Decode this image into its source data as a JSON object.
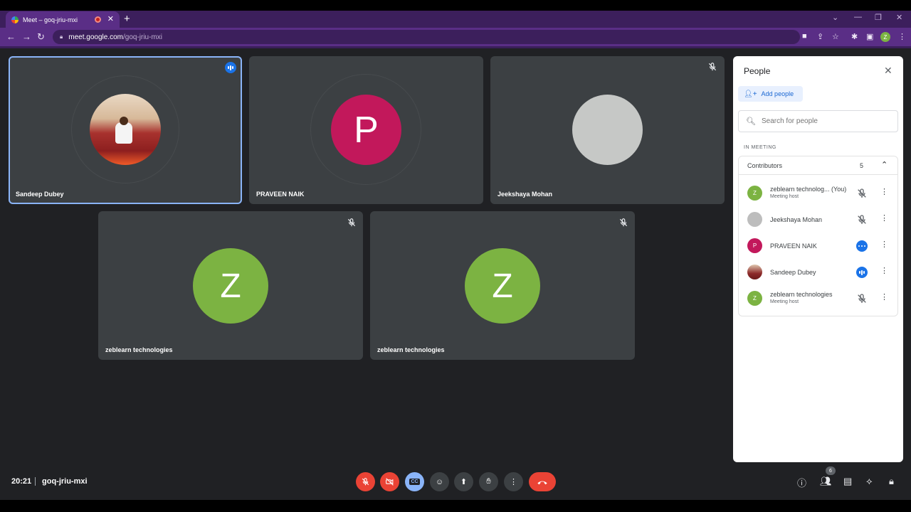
{
  "browser": {
    "tab_title": "Meet – goq-jriu-mxi",
    "tab_close": "✕",
    "new_tab": "+",
    "url_host": "meet.google.com",
    "url_path": "/goq-jriu-mxi",
    "profile_initial": "Z"
  },
  "tiles": [
    {
      "name": "Sandeep Dubey",
      "speaking": true
    },
    {
      "name": "PRAVEEN NAIK",
      "initial": "P",
      "color": "#c2185b"
    },
    {
      "name": "Jeekshaya Mohan",
      "muted": true
    },
    {
      "name": "zeblearn technologies",
      "initial": "Z",
      "color": "#7cb342",
      "muted": true
    },
    {
      "name": "zeblearn technologies",
      "initial": "Z",
      "color": "#7cb342",
      "muted": true
    }
  ],
  "people_panel": {
    "title": "People",
    "add_people": "Add people",
    "search_placeholder": "Search for people",
    "section": "IN MEETING",
    "group_label": "Contributors",
    "group_count": "5",
    "participants": [
      {
        "name": "zeblearn technolog... (You)",
        "role": "Meeting host",
        "initial": "Z",
        "color": "#7cb342",
        "status": "muted"
      },
      {
        "name": "Jeekshaya Mohan",
        "role": "",
        "initial": "",
        "color": "#bdbdbd",
        "status": "muted"
      },
      {
        "name": "PRAVEEN NAIK",
        "role": "",
        "initial": "P",
        "color": "#c2185b",
        "status": "more"
      },
      {
        "name": "Sandeep Dubey",
        "role": "",
        "initial": "",
        "color": "#8d2a2a",
        "status": "speaking"
      },
      {
        "name": "zeblearn technologies",
        "role": "Meeting host",
        "initial": "Z",
        "color": "#7cb342",
        "status": "muted"
      }
    ]
  },
  "bottom_bar": {
    "time": "20:21",
    "meeting_code": "goq-jriu-mxi",
    "people_badge": "6",
    "cc_label": "CC"
  },
  "colors": {
    "accent_blue": "#1a73e8",
    "end_call": "#ea4335",
    "chrome_purple": "#5a2e86"
  }
}
